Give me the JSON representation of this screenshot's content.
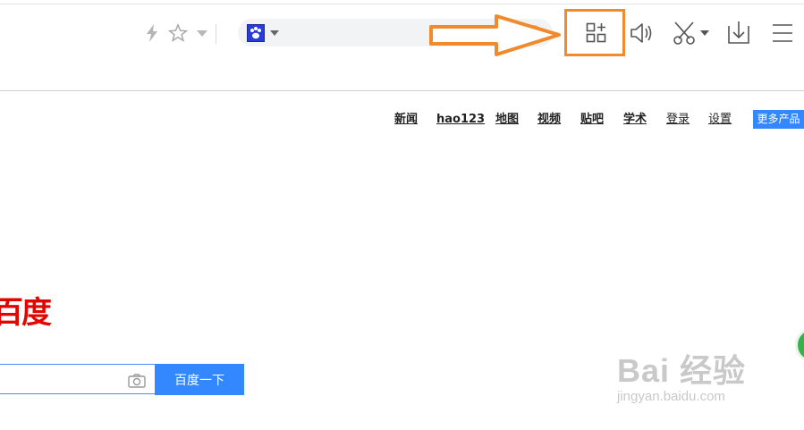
{
  "toolbar": {
    "icons": [
      "lightning-icon",
      "star-icon",
      "dropdown-icon",
      "baidu-paw-icon",
      "search-icon",
      "add-app-icon",
      "speaker-icon",
      "scissors-icon",
      "download-icon",
      "menu-icon"
    ],
    "accent_highlight": "#f08a2c"
  },
  "nav": {
    "links": [
      "新闻",
      "hao123",
      "地图",
      "视频",
      "贴吧",
      "学术",
      "登录",
      "设置"
    ],
    "more": "更多产品"
  },
  "logo": {
    "text": "百度"
  },
  "search": {
    "button": "百度一下",
    "placeholder": ""
  },
  "watermark": {
    "main": "Bai 经验",
    "sub": "jingyan.baidu.com"
  },
  "colors": {
    "brand_blue": "#3388ff",
    "logo_red": "#e10600"
  }
}
